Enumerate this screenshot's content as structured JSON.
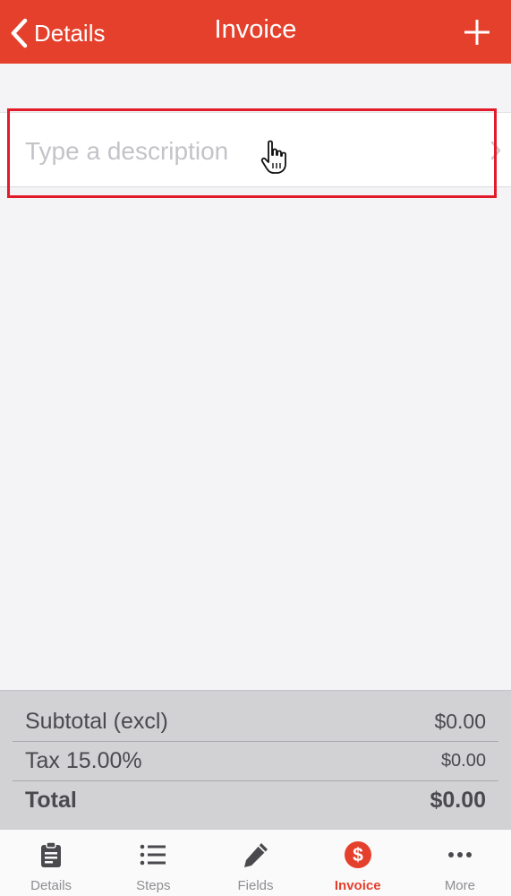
{
  "colors": {
    "brand": "#e5402c",
    "highlight": "#e21b2a",
    "placeholder": "#c4c3c8",
    "tab_inactive": "#4a4a4e"
  },
  "nav": {
    "back_label": "Details",
    "title": "Invoice",
    "add_icon": "plus-icon"
  },
  "invoice": {
    "description_placeholder": "Type a description"
  },
  "totals": {
    "subtotal_label": "Subtotal (excl)",
    "subtotal_value": "$0.00",
    "tax_label": "Tax 15.00%",
    "tax_value": "$0.00",
    "total_label": "Total",
    "total_value": "$0.00"
  },
  "tabs": [
    {
      "label": "Details",
      "icon": "clipboard-icon",
      "active": false
    },
    {
      "label": "Steps",
      "icon": "list-icon",
      "active": false
    },
    {
      "label": "Fields",
      "icon": "pencil-icon",
      "active": false
    },
    {
      "label": "Invoice",
      "icon": "dollar-circle-icon",
      "active": true
    },
    {
      "label": "More",
      "icon": "ellipsis-icon",
      "active": false
    }
  ]
}
